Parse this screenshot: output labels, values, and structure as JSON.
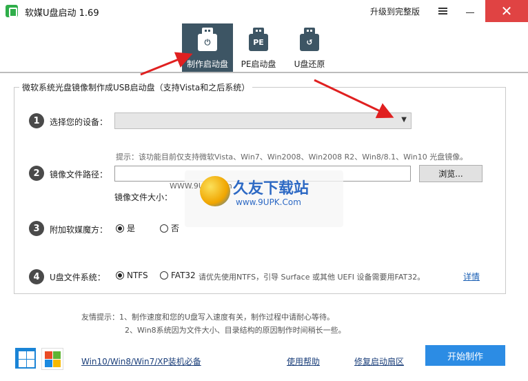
{
  "window": {
    "title": "软媒U盘启动 1.69",
    "upgrade_label": "升级到完整版",
    "close_glyph": "✕"
  },
  "toolbar": {
    "tabs": [
      {
        "label": "制作启动盘",
        "icon": "power-usb-icon",
        "active": true
      },
      {
        "label": "PE启动盘",
        "icon": "pe-usb-icon",
        "badge": "PE",
        "active": false
      },
      {
        "label": "U盘还原",
        "icon": "restore-usb-icon",
        "active": false
      }
    ]
  },
  "form": {
    "group_title": "微软系统光盘镜像制作成USB启动盘（支持Vista和之后系统）",
    "step1": {
      "num": "1",
      "label": "选择您的设备："
    },
    "hint": "提示：该功能目前仅支持微软Vista、Win7、Win2008、Win2008 R2、Win8/8.1、Win10 光盘镜像。",
    "step2": {
      "num": "2",
      "label": "镜像文件路径：",
      "path_value": "",
      "browse_label": "浏览...",
      "size_label": "镜像文件大小："
    },
    "step3": {
      "num": "3",
      "label": "附加软媒魔方：",
      "options": [
        "是",
        "否"
      ],
      "selected": "是"
    },
    "step4": {
      "num": "4",
      "label": "U盘文件系统：",
      "options": [
        "NTFS",
        "FAT32"
      ],
      "selected": "NTFS",
      "note": "请优先使用NTFS，引导 Surface 或其他 UEFI 设备需要用FAT32。",
      "detail_label": "详情"
    }
  },
  "tips": {
    "line1": "友情提示：1、制作速度和您的U盘写入速度有关，制作过程中请耐心等待。",
    "line2": "2、Win8系统因为文件大小、目录结构的原因制作时间稍长一些。"
  },
  "footer": {
    "link_systems": "Win10/Win8/Win7/XP装机必备",
    "link_help": "使用帮助",
    "link_repair": "修复启动扇区",
    "start_label": "开始制作"
  },
  "watermark": {
    "name": "久友下载站",
    "url": "www.9UPK.Com",
    "prefix": "WWW.9UPK.com"
  },
  "colors": {
    "toolbar_active": "#3d5564",
    "close_button": "#e04343",
    "start_button": "#2c8ce4",
    "annotation_arrow": "#e02020"
  }
}
